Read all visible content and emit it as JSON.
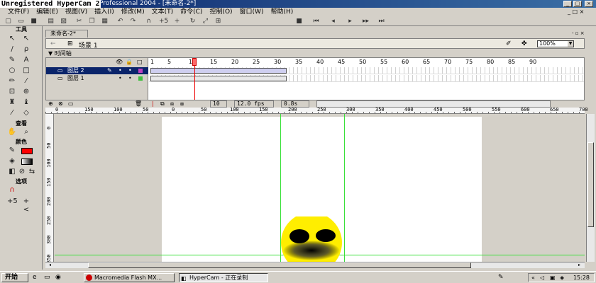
{
  "watermark": "Unregistered HyperCam 2",
  "window": {
    "title": "Professional 2004 - [未命名-2*]"
  },
  "menu": [
    "文件(F)",
    "编辑(E)",
    "视图(V)",
    "插入(I)",
    "修改(M)",
    "文本(T)",
    "命令(C)",
    "控制(O)",
    "窗口(W)",
    "帮助(H)"
  ],
  "tools": {
    "header": "工具",
    "view_header": "查看",
    "colors_header": "颜色",
    "options_header": "选项"
  },
  "document": {
    "tab": "未命名-2*",
    "scene": "场景 1",
    "zoom": "100%"
  },
  "timeline": {
    "title": "时间轴",
    "layers": [
      {
        "name": "图层 2",
        "selected": true
      },
      {
        "name": "图层 1",
        "selected": false
      }
    ],
    "frame_numbers": [
      "1",
      "5",
      "10",
      "15",
      "20",
      "25",
      "30",
      "35",
      "40",
      "45",
      "50",
      "55",
      "60",
      "65",
      "70",
      "75",
      "80",
      "85",
      "90"
    ],
    "current_frame": "10",
    "fps": "12.0 fps",
    "time": "0.8s"
  },
  "ruler": {
    "h_labels": [
      "0",
      "150",
      "100",
      "50",
      "0",
      "50",
      "100",
      "150",
      "200",
      "250",
      "300",
      "350",
      "400",
      "450",
      "500",
      "550",
      "600",
      "650",
      "700"
    ],
    "v_labels": [
      "0",
      "50",
      "100",
      "150",
      "200",
      "250",
      "300",
      "350"
    ]
  },
  "taskbar": {
    "start": "开始",
    "tasks": [
      {
        "label": "Macromedia Flash MX...",
        "active": false
      },
      {
        "label": "HyperCam - 正在录制",
        "active": true
      }
    ],
    "clock": "15:28"
  },
  "colors": {
    "title_start": "#0a246a",
    "title_end": "#3a6ea5",
    "guide": "#39e039",
    "playhead": "#ff6666",
    "face_fill": "#ffee00",
    "fill_swatch": "#ff0000"
  }
}
